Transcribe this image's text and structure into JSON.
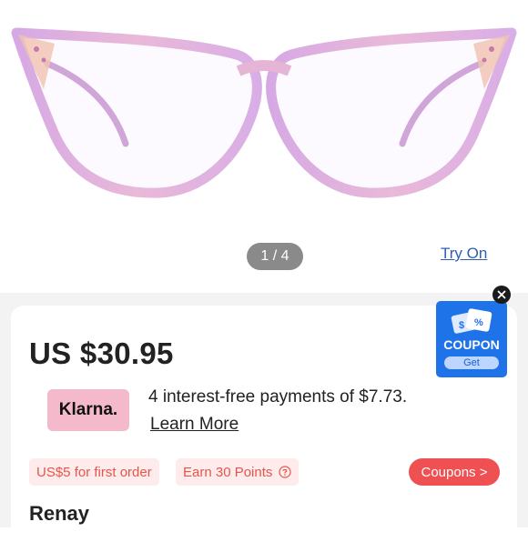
{
  "gallery": {
    "image_name": "cat-eye eyeglasses frame",
    "pager_text": "1 / 4",
    "try_on_label": "Try On"
  },
  "product": {
    "price": "US $30.95",
    "name": "Renay"
  },
  "klarna": {
    "logo_text": "Klarna.",
    "message": "4 interest-free payments of $7.73.",
    "learn_more": "Learn More"
  },
  "promos": {
    "first_order": "US$5 for first order",
    "points": "Earn 30 Points",
    "coupons_button": "Coupons >"
  },
  "coupon_widget": {
    "label": "COUPON",
    "get_label": "Get"
  },
  "colors": {
    "accent_red": "#ef5052",
    "link_blue": "#2f5fb3",
    "coupon_blue": "#1f73e8",
    "klarna_pink": "#f5b9cc",
    "frame_pink": "#e2b5e6"
  },
  "icons": [
    "question-circle-icon",
    "close-icon",
    "coupon-tickets-icon"
  ]
}
